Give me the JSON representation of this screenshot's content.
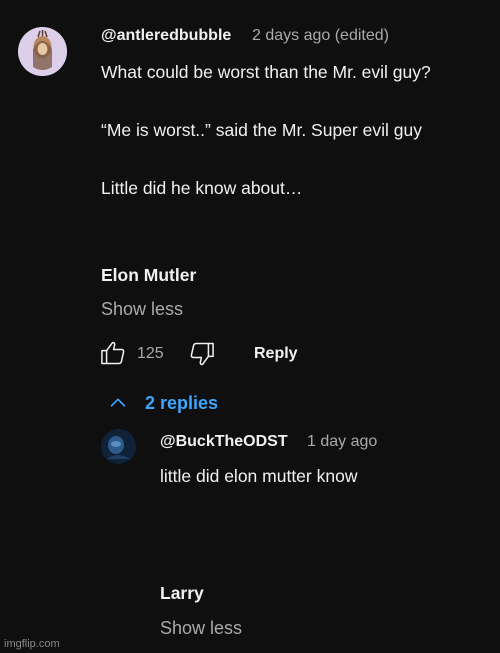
{
  "comment": {
    "author": "@antleredbubble",
    "meta": "2 days ago (edited)",
    "lines": [
      "What could be worst than the Mr. evil guy?",
      "“Me is worst..” said the Mr. Super evil guy",
      "Little did he know about…"
    ],
    "name_line": "Elon Mutler",
    "show_less_label": "Show less",
    "like_count": "125",
    "reply_label": "Reply",
    "replies_toggle_label": "2 replies"
  },
  "reply": {
    "author": "@BuckTheODST",
    "meta": "1 day ago",
    "line": "little did elon mutter know",
    "name_line": "Larry",
    "show_less_label": "Show less"
  },
  "watermark": "imgflip.com",
  "icons": {
    "like": "thumbs-up-icon",
    "dislike": "thumbs-down-icon",
    "collapse": "chevron-up-icon"
  },
  "colors": {
    "background": "#0f0f0f",
    "text": "#f1f1f1",
    "secondary": "#aaaaaa",
    "link": "#3ea6ff"
  }
}
